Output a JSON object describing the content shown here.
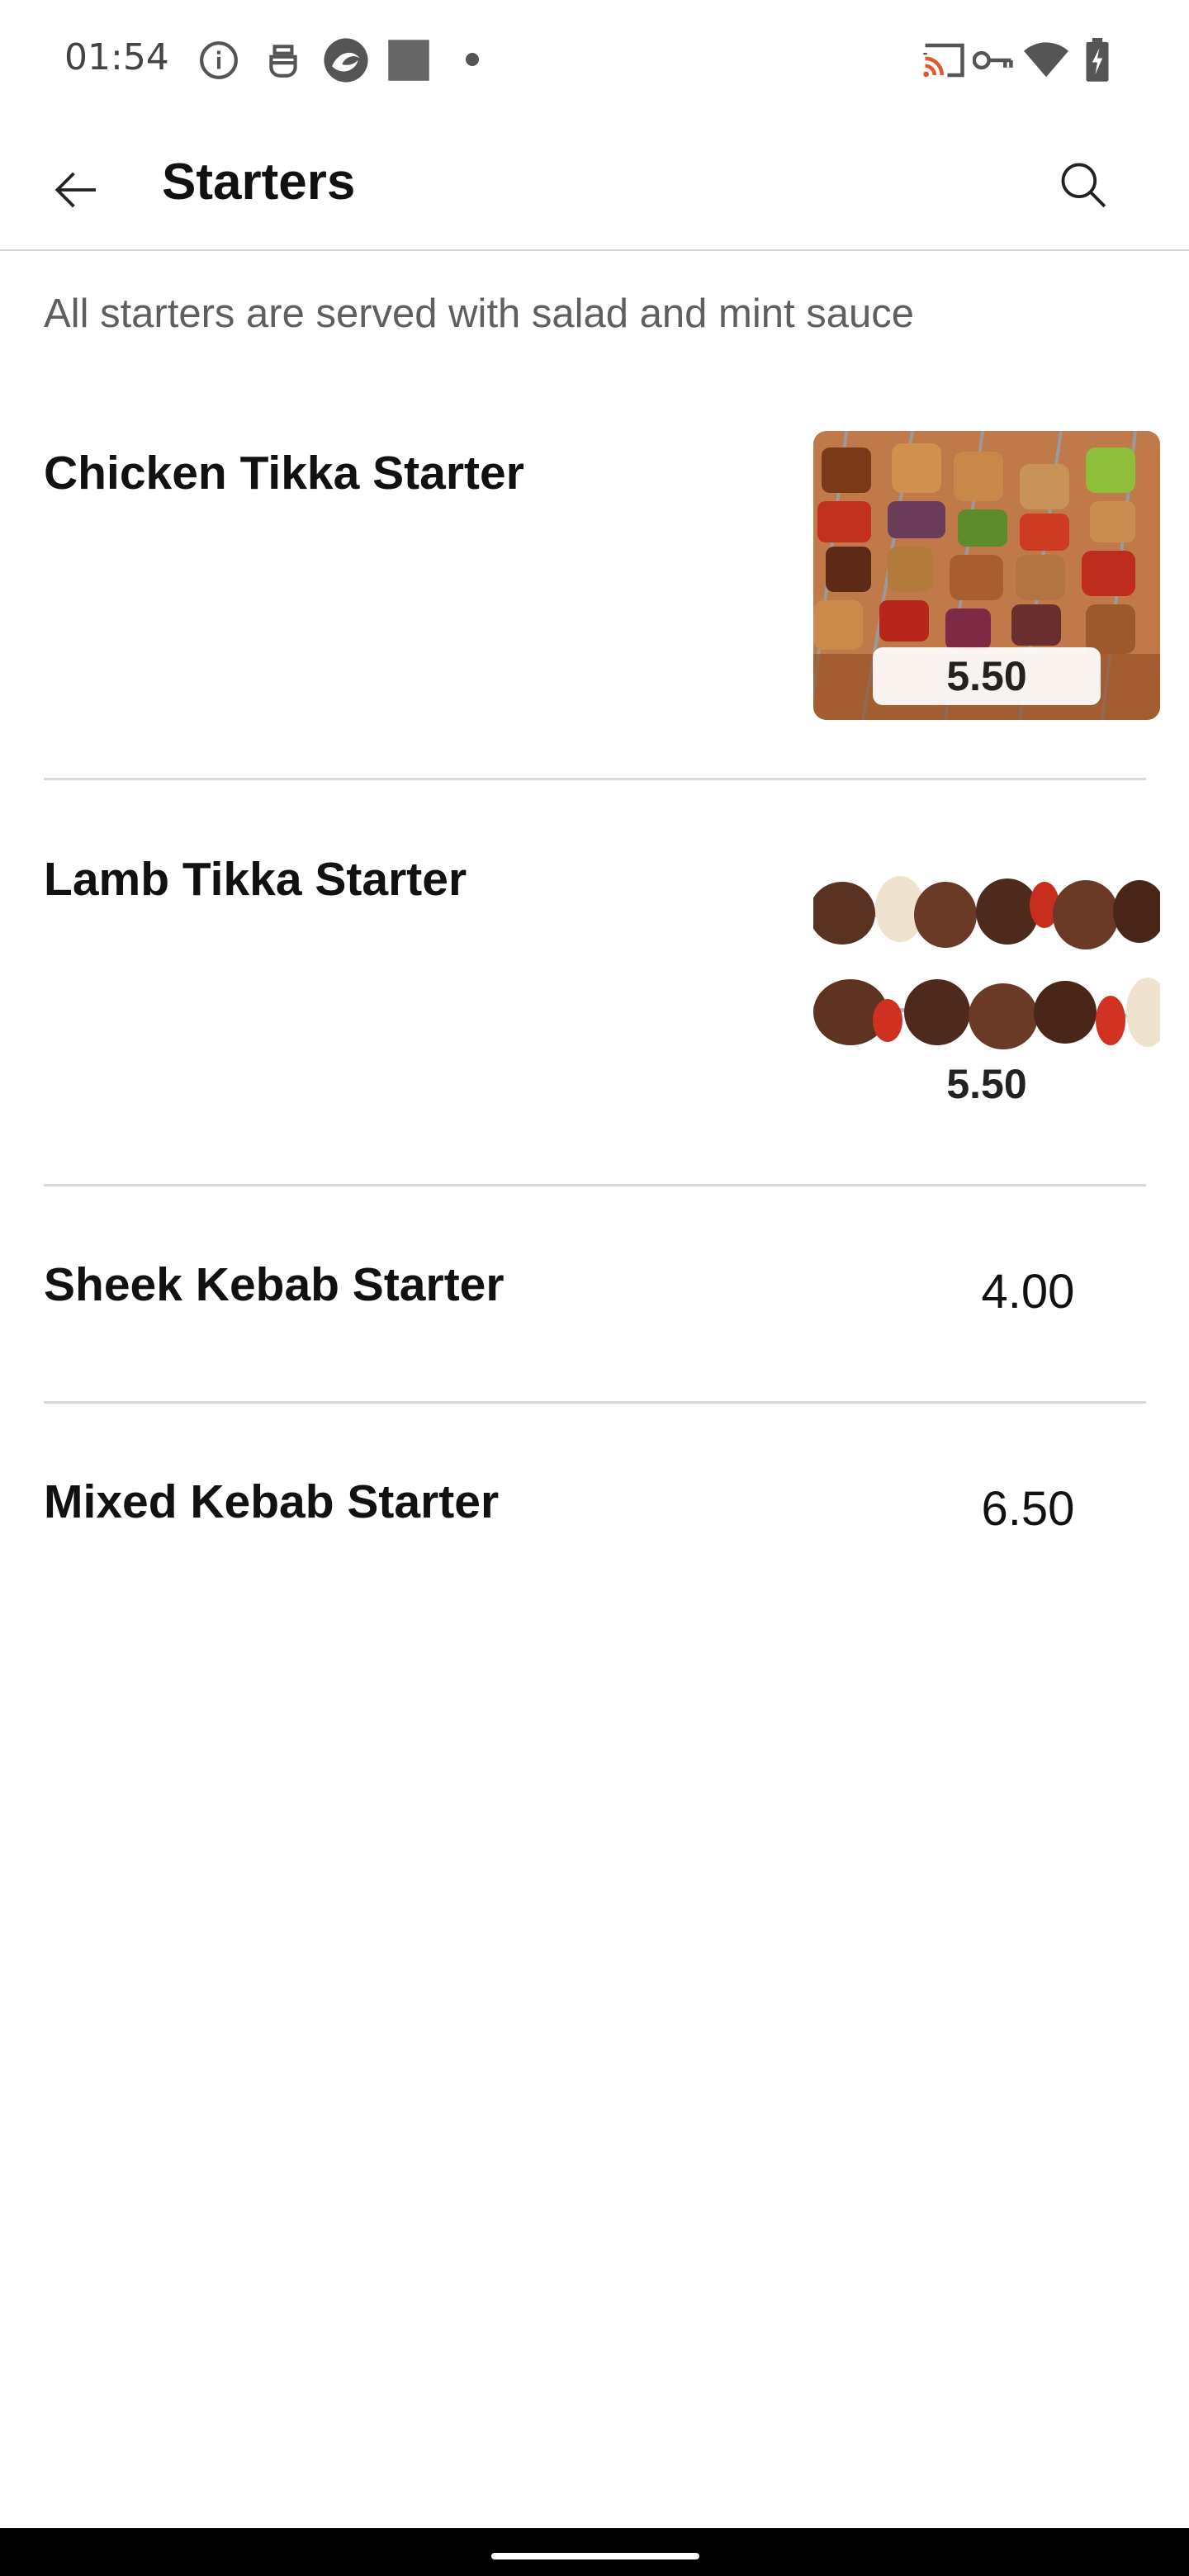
{
  "status_bar": {
    "time": "01:54",
    "left_icons": [
      "info-icon",
      "robot-icon",
      "browser-icon",
      "square-icon",
      "dot-icon"
    ],
    "right_icons": [
      "cast-icon",
      "vpn-key-icon",
      "wifi-icon",
      "battery-charging-icon"
    ]
  },
  "app_bar": {
    "title": "Starters",
    "back_icon": "arrow-back-icon",
    "search_icon": "search-icon"
  },
  "section": {
    "description": "All starters are served with salad and mint sauce"
  },
  "items": [
    {
      "name": "Chicken Tikka Starter",
      "price": "5.50",
      "image": "chicken-tikka-skewers"
    },
    {
      "name": "Lamb Tikka Starter",
      "price": "5.50",
      "image": "lamb-tikka-skewers"
    },
    {
      "name": "Sheek Kebab Starter",
      "price": "4.00"
    },
    {
      "name": "Mixed Kebab Starter",
      "price": "6.50"
    }
  ],
  "colors": {
    "background": "#ffffff",
    "text": "#111111",
    "secondary_text": "#5f5f5f",
    "divider": "#d9d9d9",
    "nav_bar": "#000000"
  }
}
